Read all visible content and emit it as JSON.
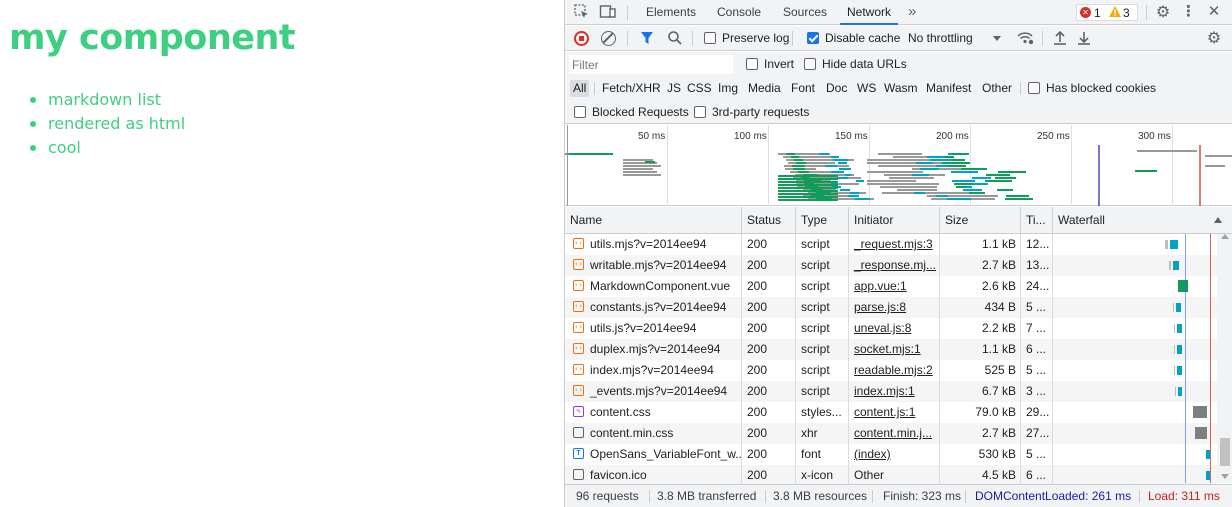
{
  "page": {
    "heading": "my component",
    "list": [
      "markdown list",
      "rendered as html",
      "cool"
    ]
  },
  "devtools": {
    "tabs": [
      "Elements",
      "Console",
      "Sources",
      "Network"
    ],
    "active_tab": "Network",
    "more_tabs": "»",
    "errors": "1",
    "warnings": "3",
    "toolbar": {
      "preserve_log": "Preserve log",
      "preserve_log_checked": false,
      "disable_cache": "Disable cache",
      "disable_cache_checked": true,
      "throttling": "No throttling"
    },
    "filter": {
      "placeholder": "Filter",
      "invert": "Invert",
      "hide_data_urls": "Hide data URLs"
    },
    "types": [
      "All",
      "Fetch/XHR",
      "JS",
      "CSS",
      "Img",
      "Media",
      "Font",
      "Doc",
      "WS",
      "Wasm",
      "Manifest",
      "Other"
    ],
    "active_type": "All",
    "has_blocked_cookies": "Has blocked cookies",
    "blocked_requests": "Blocked Requests",
    "third_party": "3rd-party requests",
    "overview_ticks": [
      "50 ms",
      "100 ms",
      "150 ms",
      "200 ms",
      "250 ms",
      "300 ms"
    ],
    "columns": [
      "Name",
      "Status",
      "Type",
      "Initiator",
      "Size",
      "Ti...",
      "Waterfall"
    ],
    "rows": [
      {
        "name": "utils.mjs?v=2014ee94",
        "status": "200",
        "type": "script",
        "initiator": "_request.mjs:3",
        "size": "1.1 kB",
        "time": "12...",
        "kind": "js"
      },
      {
        "name": "writable.mjs?v=2014ee94",
        "status": "200",
        "type": "script",
        "initiator": "_response.mj...",
        "size": "2.7 kB",
        "time": "13...",
        "kind": "js"
      },
      {
        "name": "MarkdownComponent.vue",
        "status": "200",
        "type": "script",
        "initiator": "app.vue:1",
        "size": "2.6 kB",
        "time": "24...",
        "kind": "js"
      },
      {
        "name": "constants.js?v=2014ee94",
        "status": "200",
        "type": "script",
        "initiator": "parse.js:8",
        "size": "434 B",
        "time": "5 ...",
        "kind": "js"
      },
      {
        "name": "utils.js?v=2014ee94",
        "status": "200",
        "type": "script",
        "initiator": "uneval.js:8",
        "size": "2.2 kB",
        "time": "7 ...",
        "kind": "js"
      },
      {
        "name": "duplex.mjs?v=2014ee94",
        "status": "200",
        "type": "script",
        "initiator": "socket.mjs:1",
        "size": "1.1 kB",
        "time": "6 ...",
        "kind": "js"
      },
      {
        "name": "index.mjs?v=2014ee94",
        "status": "200",
        "type": "script",
        "initiator": "readable.mjs:2",
        "size": "525 B",
        "time": "5 ...",
        "kind": "js"
      },
      {
        "name": "_events.mjs?v=2014ee94",
        "status": "200",
        "type": "script",
        "initiator": "index.mjs:1",
        "size": "6.7 kB",
        "time": "3 ...",
        "kind": "js"
      },
      {
        "name": "content.css",
        "status": "200",
        "type": "styles...",
        "initiator": "content.js:1",
        "size": "79.0 kB",
        "time": "29...",
        "kind": "css"
      },
      {
        "name": "content.min.css",
        "status": "200",
        "type": "xhr",
        "initiator": "content.min.j...",
        "size": "2.7 kB",
        "time": "27...",
        "kind": "doc"
      },
      {
        "name": "OpenSans_VariableFont_w...",
        "status": "200",
        "type": "font",
        "initiator": "(index)",
        "size": "530 kB",
        "time": "5 ...",
        "kind": "font"
      },
      {
        "name": "favicon.ico",
        "status": "200",
        "type": "x-icon",
        "initiator": "Other",
        "size": "4.5 kB",
        "time": "6 ...",
        "kind": "doc"
      }
    ],
    "status": {
      "requests": "96 requests",
      "transferred": "3.8 MB transferred",
      "resources": "3.8 MB resources",
      "finish": "Finish: 323 ms",
      "dom_content_loaded": "DOMContentLoaded: 261 ms",
      "load": "Load: 311 ms"
    },
    "colors": {
      "accent": "#1a73e8",
      "page_green": "#3fcf82",
      "dcl_blue": "#1a1aa6",
      "load_red": "#c5221f"
    }
  }
}
